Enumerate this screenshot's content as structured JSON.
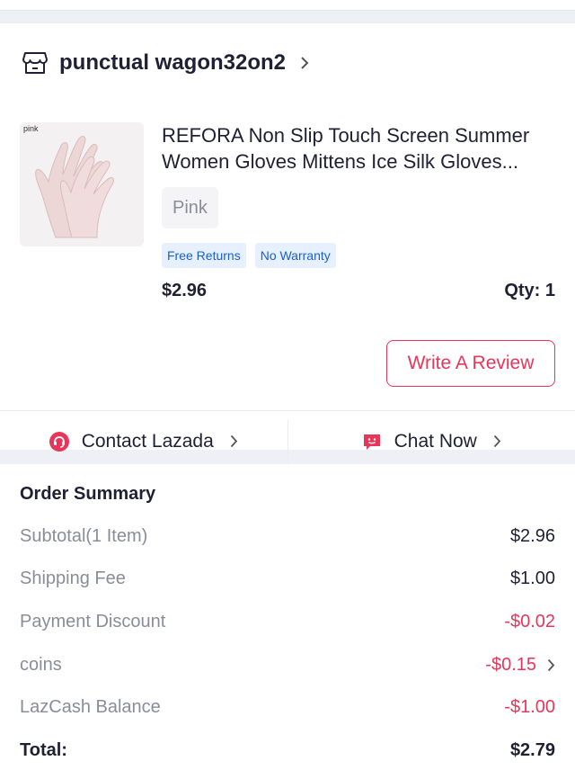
{
  "shop": {
    "name": "punctual wagon32on2",
    "icon": "store-icon"
  },
  "product": {
    "thumb_label": "pink",
    "title": "REFORA Non Slip Touch Screen Summer Women Gloves Mittens Ice Silk Gloves...",
    "variant": "Pink",
    "tags": [
      "Free Returns",
      "No Warranty"
    ],
    "price": "$2.96",
    "qty": "Qty: 1"
  },
  "actions": {
    "write_review": "Write A Review",
    "contact_label": "Contact Lazada",
    "chat_label": "Chat Now"
  },
  "summary": {
    "title": "Order Summary",
    "rows": [
      {
        "label": "Subtotal(1 Item)",
        "value": "$2.96"
      },
      {
        "label": "Shipping Fee",
        "value": "$1.00"
      },
      {
        "label": "Payment Discount",
        "value": "-$0.02"
      },
      {
        "label": "coins",
        "value": "-$0.15"
      },
      {
        "label": "LazCash Balance",
        "value": "-$1.00"
      }
    ],
    "total_label": "Total:",
    "total_value": "$2.79"
  },
  "colors": {
    "accent": "#e8365a",
    "tag_bg": "#e6f0ff",
    "tag_text": "#1a5fd1",
    "muted": "#8a8c99"
  }
}
